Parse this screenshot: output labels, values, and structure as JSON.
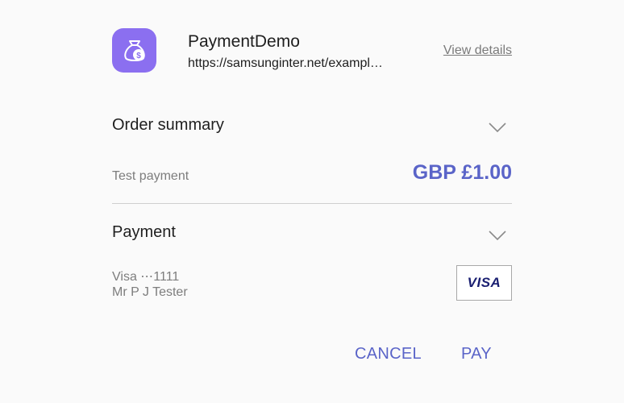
{
  "app": {
    "name": "PaymentDemo",
    "url": "https://samsunginter.net/exampl…",
    "view_details_label": "View details",
    "icon": "money-bag-icon",
    "icon_color": "#8b6ff0"
  },
  "order_summary": {
    "title": "Order summary",
    "item_label": "Test payment",
    "amount": "GBP £1.00"
  },
  "payment": {
    "title": "Payment",
    "card_line": "Visa ⋯1111",
    "cardholder": "Mr P J Tester",
    "card_brand": "VISA"
  },
  "actions": {
    "cancel_label": "CANCEL",
    "pay_label": "PAY"
  },
  "colors": {
    "accent": "#5a64c8",
    "background": "#fafafa"
  }
}
